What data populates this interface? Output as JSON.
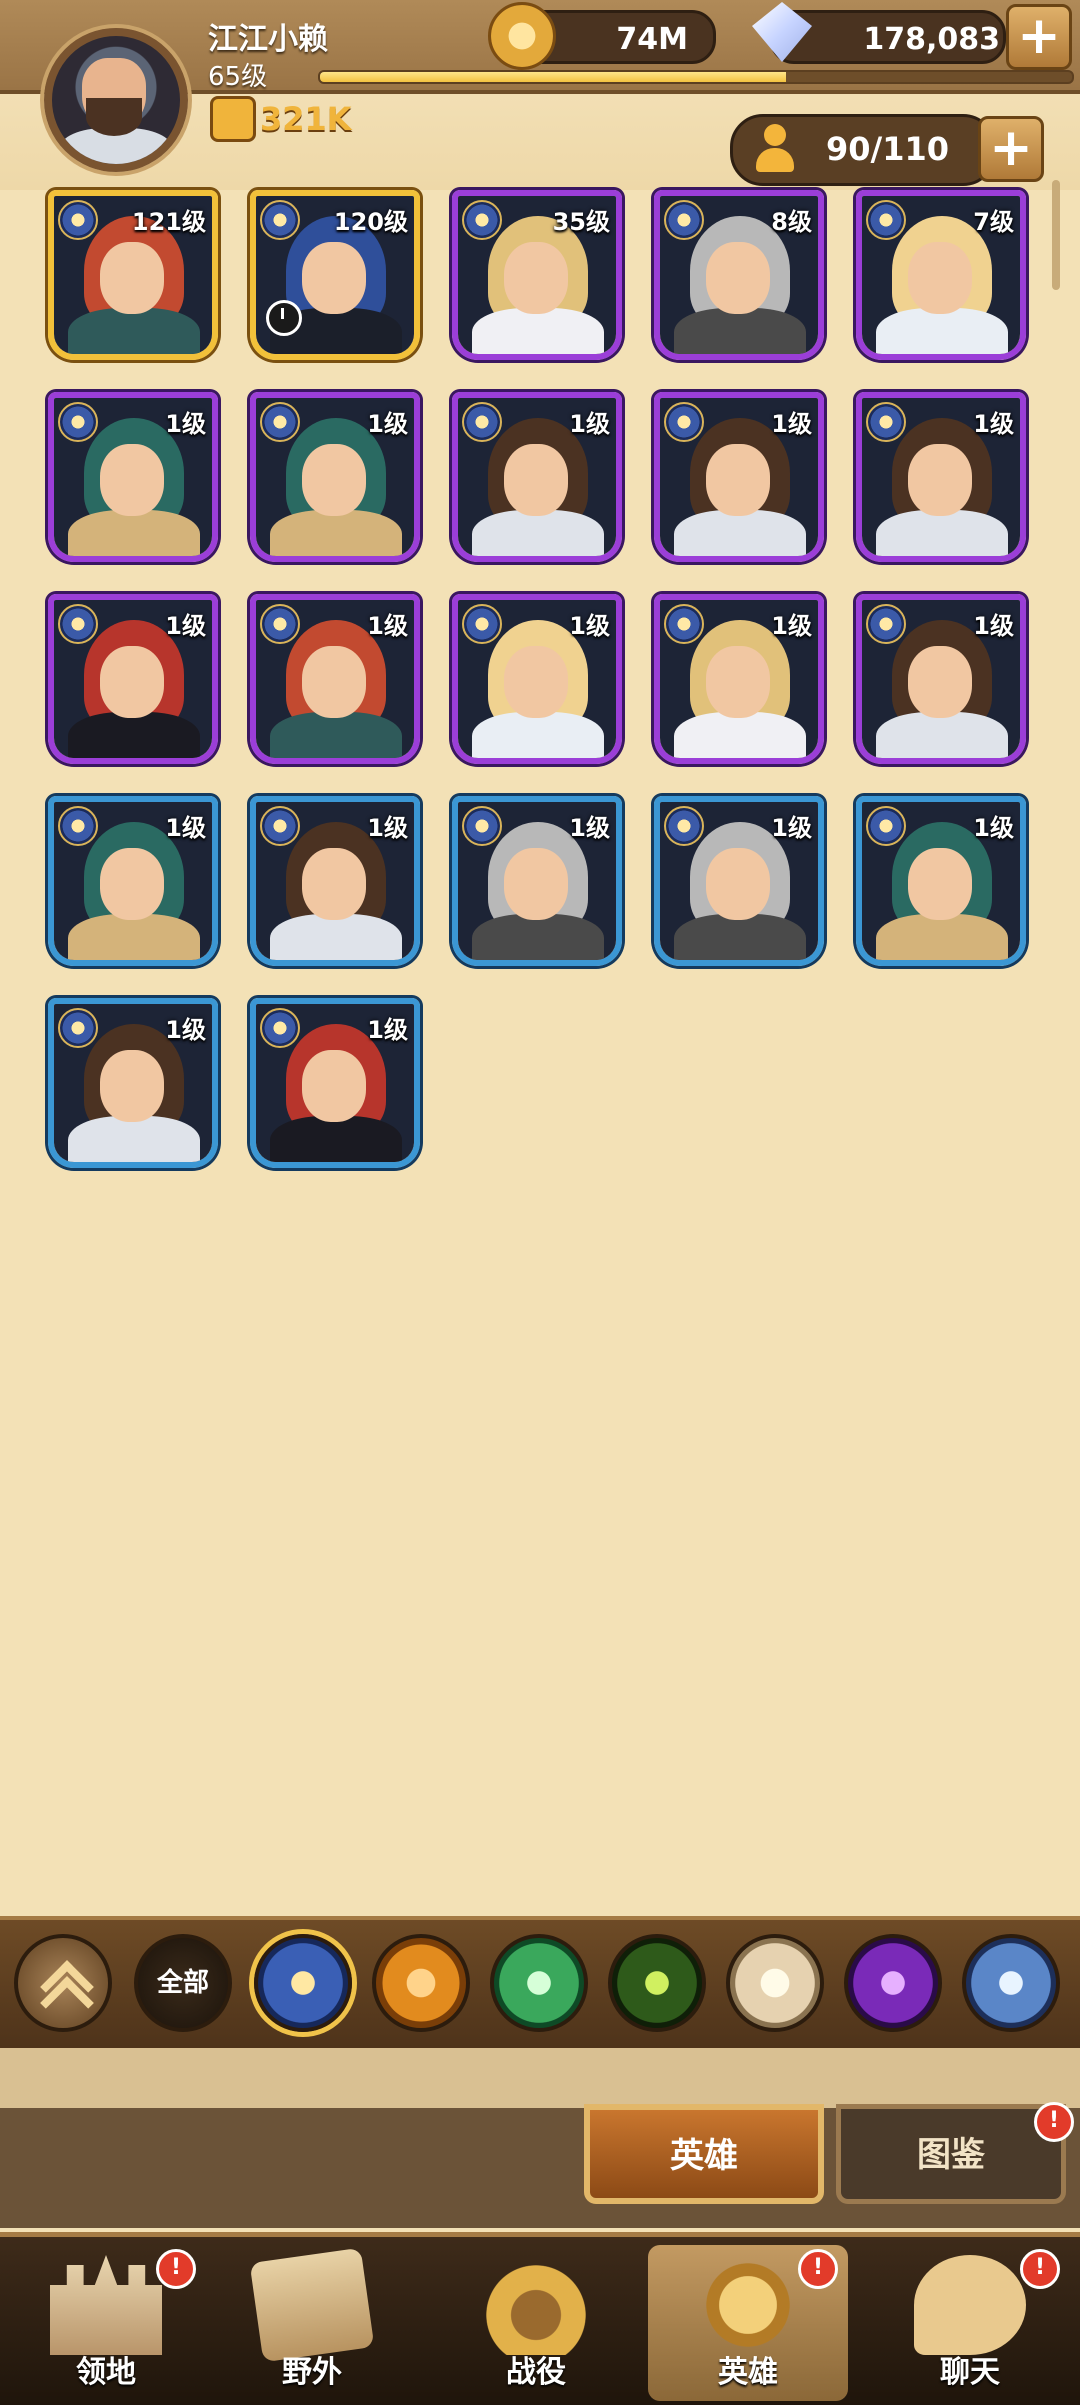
{
  "header": {
    "player_name": "江江小赖",
    "player_level": "65级",
    "power": "321K",
    "xp_progress": 0.62,
    "gold": "74M",
    "diamonds": "178,083",
    "roster": "90/110"
  },
  "heroes": [
    {
      "level": "121级",
      "rarity": "gold",
      "hair": "#c24a30",
      "body": "#2f5a5a"
    },
    {
      "level": "120级",
      "rarity": "gold",
      "hair": "#2f4f9a",
      "body": "#1b1f2a",
      "timer": true
    },
    {
      "level": "35级",
      "rarity": "purple",
      "hair": "#e1c17a",
      "body": "#f0f0f4"
    },
    {
      "level": "8级",
      "rarity": "purple",
      "hair": "#b8b8b8",
      "body": "#4a4a4a"
    },
    {
      "level": "7级",
      "rarity": "purple",
      "hair": "#f0d290",
      "body": "#e9eef4"
    },
    {
      "level": "1级",
      "rarity": "purple",
      "hair": "#2a6a62",
      "body": "#d4b37a"
    },
    {
      "level": "1级",
      "rarity": "purple",
      "hair": "#2a6a62",
      "body": "#d4b37a"
    },
    {
      "level": "1级",
      "rarity": "purple",
      "hair": "#4b3222",
      "body": "#dfe3ea"
    },
    {
      "level": "1级",
      "rarity": "purple",
      "hair": "#4b3222",
      "body": "#dfe3ea"
    },
    {
      "level": "1级",
      "rarity": "purple",
      "hair": "#4b3222",
      "body": "#dfe3ea"
    },
    {
      "level": "1级",
      "rarity": "purple",
      "hair": "#b7352c",
      "body": "#1a1a22"
    },
    {
      "level": "1级",
      "rarity": "purple",
      "hair": "#c24a30",
      "body": "#2f5a5a"
    },
    {
      "level": "1级",
      "rarity": "purple",
      "hair": "#f0d290",
      "body": "#e9eef4"
    },
    {
      "level": "1级",
      "rarity": "purple",
      "hair": "#e1c17a",
      "body": "#f0f0f4"
    },
    {
      "level": "1级",
      "rarity": "purple",
      "hair": "#4b3222",
      "body": "#dfe3ea"
    },
    {
      "level": "1级",
      "rarity": "blue",
      "hair": "#2a6a62",
      "body": "#d4b37a"
    },
    {
      "level": "1级",
      "rarity": "blue",
      "hair": "#4b3222",
      "body": "#dfe3ea"
    },
    {
      "level": "1级",
      "rarity": "blue",
      "hair": "#b8b8b8",
      "body": "#4a4a4a"
    },
    {
      "level": "1级",
      "rarity": "blue",
      "hair": "#b8b8b8",
      "body": "#4a4a4a"
    },
    {
      "level": "1级",
      "rarity": "blue",
      "hair": "#2a6a62",
      "body": "#d4b37a"
    },
    {
      "level": "1级",
      "rarity": "blue",
      "hair": "#4b3222",
      "body": "#dfe3ea"
    },
    {
      "level": "1级",
      "rarity": "blue",
      "hair": "#b7352c",
      "body": "#1a1a22"
    }
  ],
  "filters": {
    "all_label": "全部",
    "items": [
      "collapse-icon",
      "all",
      "lightbearer-icon",
      "mauler-icon",
      "wilder-icon",
      "graveborn-icon",
      "celestial-icon",
      "hypogean-icon",
      "dimensional-icon"
    ],
    "selected": "lightbearer-icon"
  },
  "sub_tabs": {
    "heroes": "英雄",
    "codex": "图鉴",
    "badge": "!"
  },
  "nav": {
    "items": [
      {
        "label": "领地",
        "icon": "castle-icon",
        "badge": "!"
      },
      {
        "label": "野外",
        "icon": "scroll-map-icon",
        "badge": ""
      },
      {
        "label": "战役",
        "icon": "battle-helmet-icon",
        "badge": ""
      },
      {
        "label": "英雄",
        "icon": "knight-helmet-icon",
        "badge": "!",
        "active": true
      },
      {
        "label": "聊天",
        "icon": "chat-icon",
        "badge": "!"
      }
    ]
  }
}
